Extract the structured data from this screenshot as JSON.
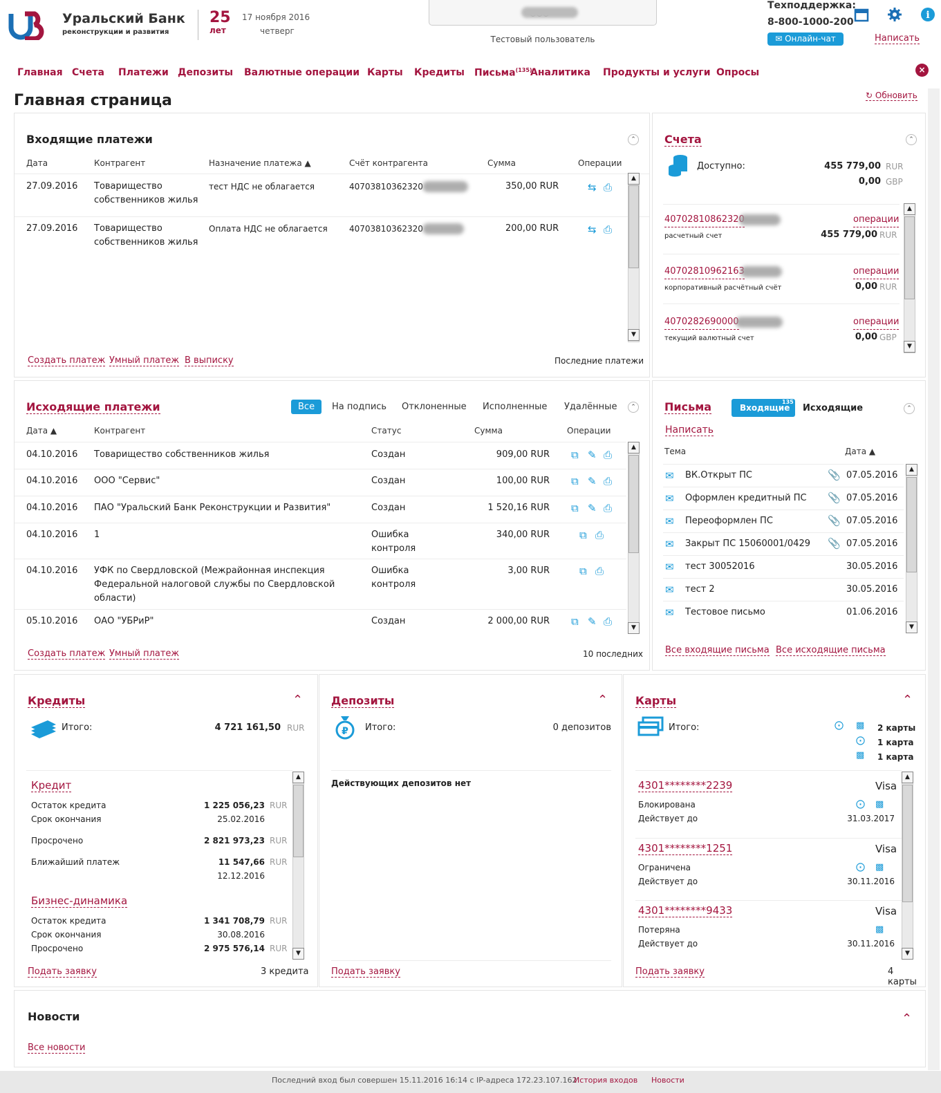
{
  "header": {
    "bank_name": "Уральский Банк",
    "bank_sub": "реконструкции и развития",
    "anniversary_num": "25",
    "anniversary_word": "лет",
    "date": "17 ноября 2016",
    "weekday": "четверг",
    "org_name": "ООО \"",
    "user": "Тестовый пользователь",
    "support_label": "Техподдержка:",
    "support_phone": "8-800-1000-200",
    "chat": "Онлайн-чат",
    "write": "Написать"
  },
  "nav": [
    {
      "label": "Главная"
    },
    {
      "label": "Счета"
    },
    {
      "label": "Платежи"
    },
    {
      "label": "Депозиты"
    },
    {
      "label": "Валютные операции"
    },
    {
      "label": "Карты"
    },
    {
      "label": "Кредиты"
    },
    {
      "label": "Письма",
      "badge": "(135)"
    },
    {
      "label": "Аналитика"
    },
    {
      "label": "Продукты и услуги"
    },
    {
      "label": "Опросы"
    }
  ],
  "page": {
    "title": "Главная страница",
    "refresh": "Обновить"
  },
  "incoming": {
    "title": "Входящие платежи",
    "headers": [
      "Дата",
      "Контрагент",
      "Назначение платежа ▲",
      "Счёт контрагента",
      "Сумма",
      "Операции"
    ],
    "rows": [
      {
        "date": "27.09.2016",
        "contr": "Товарищество собственников жилья",
        "purpose": "тест НДС не облагается",
        "account": "40703810362320",
        "sum": "350,00 RUR"
      },
      {
        "date": "27.09.2016",
        "contr": "Товарищество собственников жилья",
        "purpose": "Оплата НДС не облагается",
        "account": "40703810362320",
        "sum": "200,00 RUR"
      }
    ],
    "links": [
      "Создать платеж",
      "Умный платеж",
      "В выписку"
    ],
    "last": "Последние платежи"
  },
  "accounts": {
    "title": "Счета",
    "available": "Доступно:",
    "balances": [
      {
        "amount": "455 779,00",
        "cur": "RUR"
      },
      {
        "amount": "0,00",
        "cur": "GBP"
      }
    ],
    "items": [
      {
        "num": "40702810862320",
        "ops": "операции",
        "type": "расчетный счет",
        "amount": "455 779,00",
        "cur": "RUR"
      },
      {
        "num": "40702810962163",
        "ops": "операции",
        "type": "корпоративный расчётный счёт",
        "amount": "0,00",
        "cur": "RUR"
      },
      {
        "num": "4070282690000",
        "ops": "операции",
        "type": "текущий валютный счет",
        "amount": "0,00",
        "cur": "GBP"
      }
    ]
  },
  "outgoing": {
    "title": "Исходящие платежи",
    "tabs": [
      "Все",
      "На подпись",
      "Отклоненные",
      "Исполненные",
      "Удалённые"
    ],
    "headers": [
      "Дата ▲",
      "Контрагент",
      "Статус",
      "Сумма",
      "Операции"
    ],
    "rows": [
      {
        "date": "04.10.2016",
        "contr": "Товарищество собственников жилья",
        "status": "Создан",
        "sum": "909,00 RUR"
      },
      {
        "date": "04.10.2016",
        "contr": "ООО \"Сервис\"",
        "status": "Создан",
        "sum": "100,00 RUR"
      },
      {
        "date": "04.10.2016",
        "contr": "ПАО \"Уральский Банк Реконструкции и Развития\"",
        "status": "Создан",
        "sum": "1 520,16 RUR"
      },
      {
        "date": "04.10.2016",
        "contr": "1",
        "status": "Ошибка контроля",
        "sum": "340,00 RUR"
      },
      {
        "date": "04.10.2016",
        "contr": "УФК по Свердловской (Межрайонная инспекция Федеральной налоговой службы по Свердловской области)",
        "status": "Ошибка контроля",
        "sum": "3,00 RUR"
      },
      {
        "date": "05.10.2016",
        "contr": "ОАО \"УБРиР\"",
        "status": "Создан",
        "sum": "2 000,00 RUR"
      }
    ],
    "links": [
      "Создать платеж",
      "Умный платеж"
    ],
    "last": "10 последних"
  },
  "letters": {
    "title": "Письма",
    "tab_in": "Входящие",
    "tab_in_badge": "135",
    "tab_out": "Исходящие",
    "write": "Написать",
    "headers": [
      "Тема",
      "Дата ▲"
    ],
    "rows": [
      {
        "subject": "ВК.Открыт ПС",
        "date": "07.05.2016",
        "attach": true
      },
      {
        "subject": "Оформлен кредитный ПС",
        "date": "07.05.2016",
        "attach": true
      },
      {
        "subject": "Переоформлен ПС",
        "date": "07.05.2016",
        "attach": true
      },
      {
        "subject": "Закрыт ПС 15060001/0429",
        "date": "07.05.2016",
        "attach": true
      },
      {
        "subject": "тест 30052016",
        "date": "30.05.2016",
        "attach": false
      },
      {
        "subject": "тест 2",
        "date": "30.05.2016",
        "attach": false
      },
      {
        "subject": "Тестовое письмо",
        "date": "01.06.2016",
        "attach": false
      }
    ],
    "links": [
      "Все входящие письма",
      "Все исходящие письма"
    ]
  },
  "credits": {
    "title": "Кредиты",
    "total_label": "Итого:",
    "total": "4 721 161,50",
    "total_cur": "RUR",
    "items": [
      {
        "name": "Кредит",
        "rows": [
          {
            "label": "Остаток кредита",
            "value": "1 225 056,23",
            "cur": "RUR"
          },
          {
            "label": "Срок окончания",
            "value": "25.02.2016",
            "cur": ""
          },
          {
            "label": "Просрочено",
            "value": "2 821 973,23",
            "cur": "RUR"
          },
          {
            "label": "Ближайший платеж",
            "value": "11 547,66",
            "cur": "RUR"
          },
          {
            "label": "",
            "value": "12.12.2016",
            "cur": ""
          }
        ]
      },
      {
        "name": "Бизнес-динамика",
        "rows": [
          {
            "label": "Остаток кредита",
            "value": "1 341 708,79",
            "cur": "RUR"
          },
          {
            "label": "Срок окончания",
            "value": "30.08.2016",
            "cur": ""
          },
          {
            "label": "Просрочено",
            "value": "2 975 576,14",
            "cur": "RUR"
          }
        ]
      }
    ],
    "apply": "Подать заявку",
    "count": "3 кредита"
  },
  "deposits": {
    "title": "Депозиты",
    "total_label": "Итого:",
    "total": "0 депозитов",
    "none": "Действующих депозитов нет",
    "apply": "Подать заявку"
  },
  "cards": {
    "title": "Карты",
    "total_label": "Итого:",
    "summary": [
      "2 карты",
      "1 карта",
      "1 карта"
    ],
    "items": [
      {
        "num": "4301********2239",
        "brand": "Visa",
        "status": "Блокирована",
        "valid_label": "Действует до",
        "valid": "31.03.2017"
      },
      {
        "num": "4301********1251",
        "brand": "Visa",
        "status": "Ограничена",
        "valid_label": "Действует до",
        "valid": "30.11.2016"
      },
      {
        "num": "4301********9433",
        "brand": "Visa",
        "status": "Потеряна",
        "valid_label": "Действует до",
        "valid": "30.11.2016"
      }
    ],
    "apply": "Подать заявку",
    "count": "4 карты"
  },
  "news": {
    "title": "Новости",
    "all": "Все новости"
  },
  "footer": {
    "last_login": "Последний вход был совершен 15.11.2016 16:14 с IP-адреса 172.23.107.162",
    "history": "История входов",
    "news": "Новости"
  },
  "colors": {
    "brand": "#a3153f",
    "accent": "#1b9bd8"
  }
}
